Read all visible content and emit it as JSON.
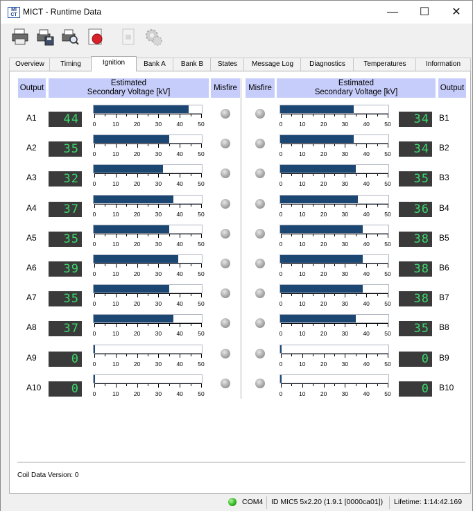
{
  "window": {
    "title": "MICT - Runtime Data",
    "app_icon_text_top": "MI",
    "app_icon_text_bottom": "CT"
  },
  "title_buttons": {
    "minimize": "—",
    "maximize": "☐",
    "close": "✕"
  },
  "toolbar": [
    {
      "icon": "print-icon"
    },
    {
      "icon": "save-icon"
    },
    {
      "icon": "search-print-icon"
    },
    {
      "icon": "record-icon"
    },
    {
      "icon": "stop-icon"
    },
    {
      "icon": "settings-icon"
    }
  ],
  "tabs": [
    "Overview",
    "Timing",
    "Ignition",
    "Bank A",
    "Bank B",
    "States",
    "Message Log",
    "Diagnostics",
    "Temperatures",
    "Information"
  ],
  "active_tab": "Ignition",
  "headers": {
    "output": "Output",
    "estimated": "Estimated",
    "secondary": "Secondary Voltage [kV]",
    "misfire": "Misfire"
  },
  "scale_labels": [
    "0",
    "10",
    "20",
    "30",
    "40",
    "50"
  ],
  "bank_a": [
    {
      "label": "A1",
      "value": 44
    },
    {
      "label": "A2",
      "value": 35
    },
    {
      "label": "A3",
      "value": 32
    },
    {
      "label": "A4",
      "value": 37
    },
    {
      "label": "A5",
      "value": 35
    },
    {
      "label": "A6",
      "value": 39
    },
    {
      "label": "A7",
      "value": 35
    },
    {
      "label": "A8",
      "value": 37
    },
    {
      "label": "A9",
      "value": 0
    },
    {
      "label": "A10",
      "value": 0
    }
  ],
  "bank_b": [
    {
      "label": "B1",
      "value": 34
    },
    {
      "label": "B2",
      "value": 34
    },
    {
      "label": "B3",
      "value": 35
    },
    {
      "label": "B4",
      "value": 36
    },
    {
      "label": "B5",
      "value": 38
    },
    {
      "label": "B6",
      "value": 38
    },
    {
      "label": "B7",
      "value": 38
    },
    {
      "label": "B8",
      "value": 35
    },
    {
      "label": "B9",
      "value": 0
    },
    {
      "label": "B10",
      "value": 0
    }
  ],
  "bar_max": 50,
  "coil_data_version": "Coil Data Version:  0",
  "status": {
    "port": "COM4",
    "id": "ID MIC5 5x2.20 (1.9.1 [0000ca01])",
    "lifetime": "Lifetime: 1:14:42.169"
  },
  "colors": {
    "header_bg": "#c7cdfa",
    "bar_fill": "#1d4773",
    "lcd_text": "#3bd86b",
    "lcd_bg": "#3a3a3a",
    "status_led": "#29b21a"
  }
}
